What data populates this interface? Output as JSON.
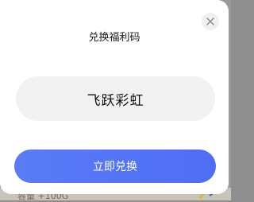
{
  "dialog": {
    "title": "兑换福利码",
    "code_value": "飞跃彩虹",
    "redeem_label": "立即兑换",
    "close_icon": "close-icon"
  },
  "background": {
    "partial_text": "容量 +100G"
  },
  "colors": {
    "accent": "#5677f6",
    "input_bg": "#f2f2f2"
  }
}
